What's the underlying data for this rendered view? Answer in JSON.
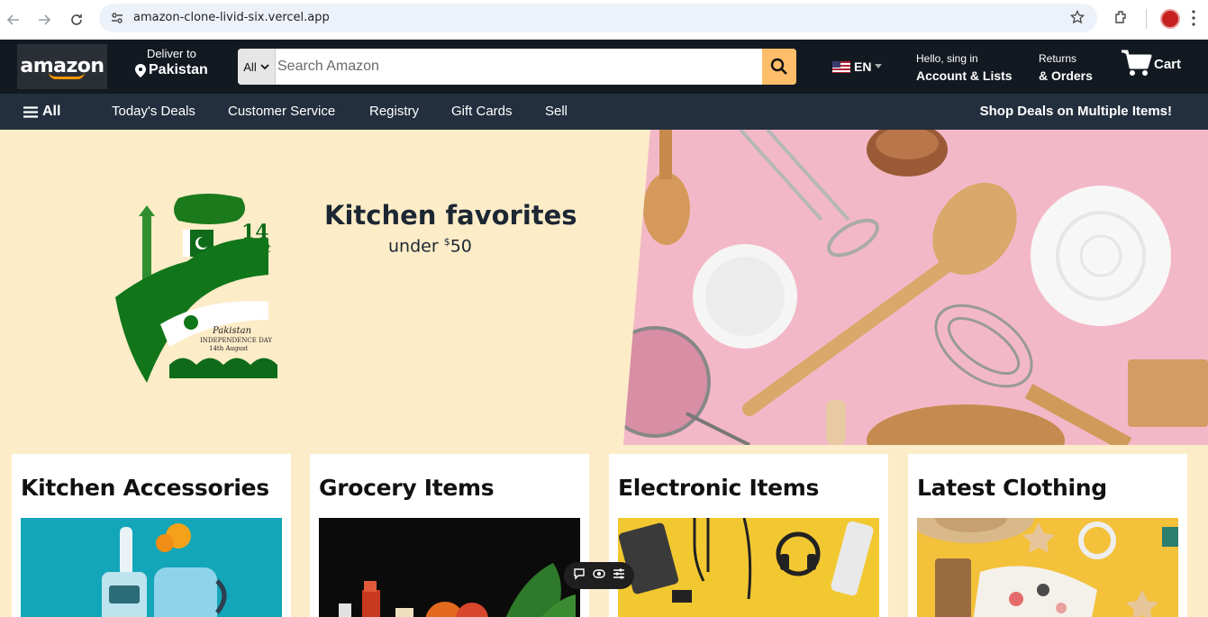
{
  "browser": {
    "url": "amazon-clone-livid-six.vercel.app"
  },
  "header": {
    "logo": "amazon",
    "deliver_label": "Deliver to",
    "deliver_location": "Pakistan",
    "search_category": "All",
    "search_placeholder": "Search Amazon",
    "language": "EN",
    "greeting": "Hello, sing in",
    "account_label": "Account & Lists",
    "returns_label": "Returns",
    "orders_label": "& Orders",
    "cart_label": "Cart"
  },
  "subnav": {
    "all_label": "All",
    "items": [
      "Today's Deals",
      "Customer Service",
      "Registry",
      "Gift Cards",
      "Sell"
    ],
    "promo": "Shop Deals on Multiple Items!"
  },
  "hero": {
    "title": "Kitchen favorites",
    "subtitle_prefix": "under ",
    "currency": "$",
    "price": "50"
  },
  "cards": [
    {
      "title": "Kitchen Accessories"
    },
    {
      "title": "Grocery Items"
    },
    {
      "title": "Electronic Items"
    },
    {
      "title": "Latest Clothing"
    }
  ],
  "colors": {
    "header_bg": "#131921",
    "subnav_bg": "#232f3e",
    "search_button": "#febd69",
    "hero_bg": "#fdecc8",
    "accent": "#ff9900"
  }
}
